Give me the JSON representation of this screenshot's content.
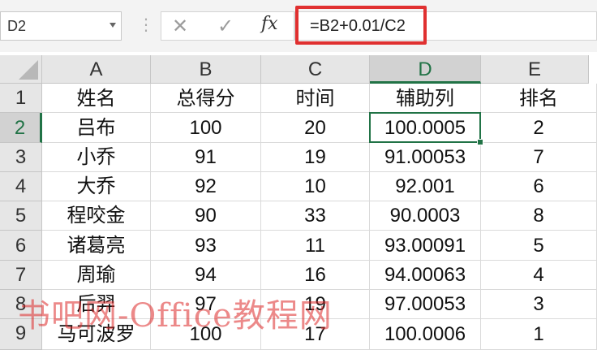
{
  "namebox": {
    "value": "D2"
  },
  "toolbar": {
    "cancel": "✕",
    "enter": "✓",
    "fx": "fx"
  },
  "formula": {
    "text": "=B2+0.01/C2"
  },
  "columns": [
    "A",
    "B",
    "C",
    "D",
    "E"
  ],
  "rows": [
    "1",
    "2",
    "3",
    "4",
    "5",
    "6",
    "7",
    "8",
    "9"
  ],
  "table": {
    "headers": [
      "姓名",
      "总得分",
      "时间",
      "辅助列",
      "排名"
    ],
    "data": [
      [
        "吕布",
        "100",
        "20",
        "100.0005",
        "2"
      ],
      [
        "小乔",
        "91",
        "19",
        "91.00053",
        "7"
      ],
      [
        "大乔",
        "92",
        "10",
        "92.001",
        "6"
      ],
      [
        "程咬金",
        "90",
        "33",
        "90.0003",
        "8"
      ],
      [
        "诸葛亮",
        "93",
        "11",
        "93.00091",
        "5"
      ],
      [
        "周瑜",
        "94",
        "16",
        "94.00063",
        "4"
      ],
      [
        "后羿",
        "97",
        "19",
        "97.00053",
        "3"
      ],
      [
        "马可波罗",
        "100",
        "17",
        "100.0006",
        "1"
      ]
    ]
  },
  "watermark": "书吧网-Office教程网",
  "colors": {
    "accent": "#217346",
    "highlight": "#e03030"
  }
}
